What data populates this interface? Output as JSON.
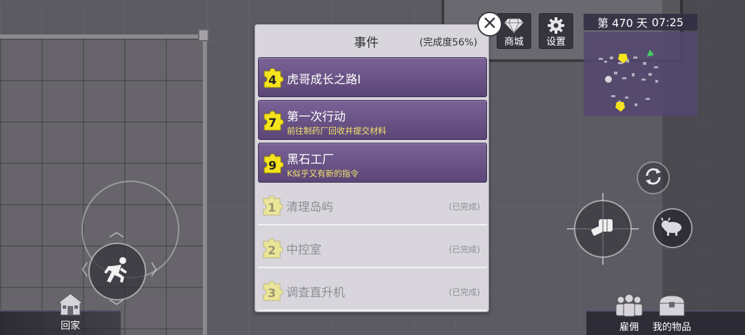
{
  "hud": {
    "shop_label": "商城",
    "settings_label": "设置",
    "day_label": "第 470 天",
    "time": "07:25"
  },
  "panel": {
    "title": "事件",
    "progress": "(完成度56%)"
  },
  "events": [
    {
      "badge": "4",
      "title": "虎哥成长之路I",
      "subtitle": "",
      "status": ""
    },
    {
      "badge": "7",
      "title": "第一次行动",
      "subtitle": "前往制药厂回收并提交材料",
      "status": ""
    },
    {
      "badge": "9",
      "title": "黑石工厂",
      "subtitle": "K似乎又有新的指令",
      "status": ""
    },
    {
      "badge": "1",
      "title": "清理岛屿",
      "subtitle": "",
      "status": "(已完成)"
    },
    {
      "badge": "2",
      "title": "中控室",
      "subtitle": "",
      "status": "(已完成)"
    },
    {
      "badge": "3",
      "title": "调查直升机",
      "subtitle": "",
      "status": "(已完成)"
    }
  ],
  "bottom": {
    "home_label": "回家",
    "hire_label": "雇佣",
    "items_label": "我的物品"
  },
  "colors": {
    "active_row": "#6a5386",
    "badge_yellow": "#f5e31e",
    "badge_done": "#ebe59a",
    "subtitle_yellow": "#f2e36b"
  },
  "icons": [
    "diamond-icon",
    "gear-icon",
    "close-icon",
    "puzzle-icon",
    "running-man-icon",
    "fist-icon",
    "cycle-icon",
    "bison-icon",
    "house-icon",
    "team-icon",
    "chest-icon"
  ]
}
